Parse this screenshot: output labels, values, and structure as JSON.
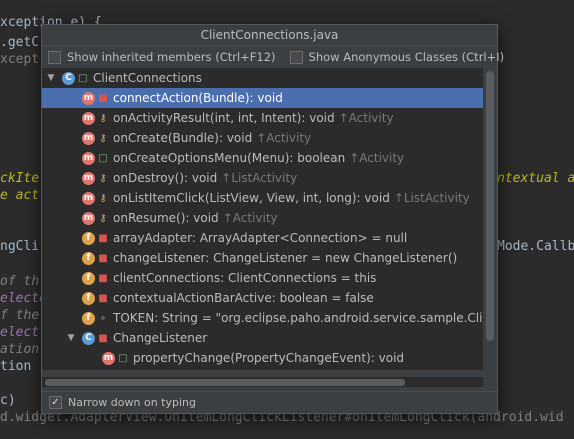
{
  "editor": {
    "lines": [
      {
        "text": "xception e) {"
      },
      {
        "text": ".getC"
      },
      {
        "text": "xcept"
      },
      {
        "text": "ckIte"
      },
      {
        "text": "e act"
      },
      {
        "text": "ngCli"
      },
      {
        "text": "of th"
      },
      {
        "text": "electe"
      },
      {
        "text": "f the"
      },
      {
        "text": "elect"
      },
      {
        "text": "ation"
      },
      {
        "text": "tion"
      },
      {
        "text": "c)"
      },
      {
        "text": "d.widget.AdapterView.OnItemLongClickListener#onItemLongClick(android.wid"
      }
    ],
    "right_lines": [
      {
        "text": "ntextual a"
      },
      {
        "text": "Mode.Callb"
      }
    ]
  },
  "popup": {
    "title": "ClientConnections.java",
    "options": {
      "show_inherited": {
        "label": "Show inherited members (Ctrl+F12)",
        "checked": false
      },
      "show_anonymous": {
        "label": "Show Anonymous Classes (Ctrl+I)",
        "checked": false
      }
    },
    "tree": [
      {
        "indent": 0,
        "arrow": "▼",
        "kind": "class",
        "badge": "C",
        "vis": "public",
        "label": "ClientConnections",
        "inherit": "",
        "selected": false
      },
      {
        "indent": 1,
        "arrow": "",
        "kind": "method",
        "badge": "m",
        "vis": "private",
        "label": "connectAction(Bundle): void",
        "inherit": "",
        "selected": true
      },
      {
        "indent": 1,
        "arrow": "",
        "kind": "method",
        "badge": "m",
        "vis": "protected",
        "label": "onActivityResult(int, int, Intent): void",
        "inherit": "↑Activity",
        "selected": false
      },
      {
        "indent": 1,
        "arrow": "",
        "kind": "method",
        "badge": "m",
        "vis": "protected",
        "label": "onCreate(Bundle): void",
        "inherit": "↑Activity",
        "selected": false
      },
      {
        "indent": 1,
        "arrow": "",
        "kind": "method",
        "badge": "m",
        "vis": "public",
        "label": "onCreateOptionsMenu(Menu): boolean",
        "inherit": "↑Activity",
        "selected": false
      },
      {
        "indent": 1,
        "arrow": "",
        "kind": "method",
        "badge": "m",
        "vis": "protected",
        "label": "onDestroy(): void",
        "inherit": "↑ListActivity",
        "selected": false
      },
      {
        "indent": 1,
        "arrow": "",
        "kind": "method",
        "badge": "m",
        "vis": "protected",
        "label": "onListItemClick(ListView, View, int, long): void",
        "inherit": "↑ListActivity",
        "selected": false
      },
      {
        "indent": 1,
        "arrow": "",
        "kind": "method",
        "badge": "m",
        "vis": "protected",
        "label": "onResume(): void",
        "inherit": "↑Activity",
        "selected": false
      },
      {
        "indent": 1,
        "arrow": "",
        "kind": "field",
        "badge": "f",
        "vis": "private",
        "label": "arrayAdapter: ArrayAdapter<Connection> = null",
        "inherit": "",
        "selected": false
      },
      {
        "indent": 1,
        "arrow": "",
        "kind": "field",
        "badge": "f",
        "vis": "private",
        "label": "changeListener: ChangeListener = new ChangeListener()",
        "inherit": "",
        "selected": false
      },
      {
        "indent": 1,
        "arrow": "",
        "kind": "field",
        "badge": "f",
        "vis": "private",
        "label": "clientConnections: ClientConnections = this",
        "inherit": "",
        "selected": false
      },
      {
        "indent": 1,
        "arrow": "",
        "kind": "field",
        "badge": "f",
        "vis": "private",
        "label": "contextualActionBarActive: boolean = false",
        "inherit": "",
        "selected": false
      },
      {
        "indent": 1,
        "arrow": "",
        "kind": "const",
        "badge": "f",
        "vis": "package",
        "label": "TOKEN: String = \"org.eclipse.paho.android.service.sample.Clie",
        "inherit": "",
        "selected": false
      },
      {
        "indent": 1,
        "arrow": "▼",
        "kind": "class",
        "badge": "C",
        "vis": "private",
        "label": "ChangeListener",
        "inherit": "",
        "selected": false
      },
      {
        "indent": 2,
        "arrow": "",
        "kind": "method",
        "badge": "m",
        "vis": "public",
        "label": "propertyChange(PropertyChangeEvent): void",
        "inherit": "",
        "selected": false
      },
      {
        "indent": 1,
        "arrow": "",
        "kind": "class",
        "badge": "C",
        "vis": "private",
        "label": "",
        "inherit": "",
        "selected": false
      }
    ],
    "footer": {
      "label": "Narrow down on typing",
      "checked": true
    }
  }
}
